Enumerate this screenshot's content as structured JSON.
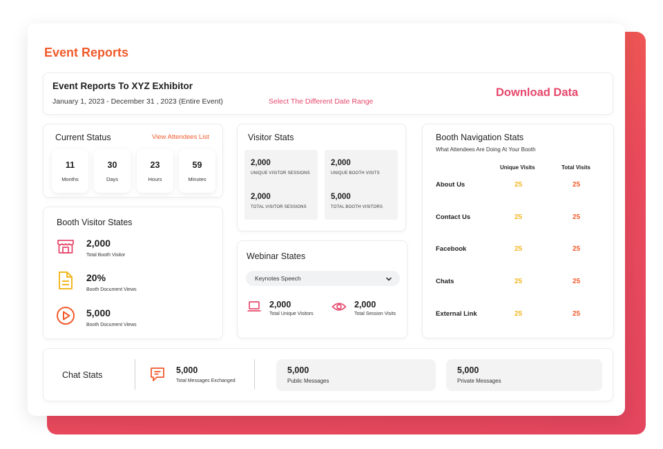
{
  "page_title": "Event Reports",
  "header": {
    "title": "Event Reports To XYZ Exhibitor",
    "dates": "January 1, 2023 - December 31 , 2023 (Entire Event)",
    "range_link": "Select The Different Date Range",
    "download": "Download Data"
  },
  "current_status": {
    "title": "Current Status",
    "link": "View Attendees List",
    "tiles": [
      {
        "value": "11",
        "label": "Months"
      },
      {
        "value": "30",
        "label": "Days"
      },
      {
        "value": "23",
        "label": "Hours"
      },
      {
        "value": "59",
        "label": "Minutes"
      }
    ]
  },
  "booth_visitor": {
    "title": "Booth Visitor States",
    "items": [
      {
        "value": "2,000",
        "label": "Total Booth Visitor",
        "icon": "storefront-icon"
      },
      {
        "value": "20%",
        "label": "Booth Document Views",
        "icon": "document-icon"
      },
      {
        "value": "5,000",
        "label": "Booth Document Views",
        "icon": "play-circle-icon"
      }
    ]
  },
  "visitor_stats": {
    "title": "Visitor Stats",
    "items": [
      {
        "value": "2,000",
        "label": "UNIQUE VISITOR SESSIONS"
      },
      {
        "value": "2,000",
        "label": "UNIQUE BOOTH VISITS"
      },
      {
        "value": "2,000",
        "label": "TOTAL VISITOR SESSIONS"
      },
      {
        "value": "5,000",
        "label": "TOTAL BOOTH VISITORS"
      }
    ]
  },
  "webinar": {
    "title": "Webinar States",
    "selected": "Keynotes Speech",
    "stats": [
      {
        "value": "2,000",
        "label": "Total Unique Visitors",
        "icon": "laptop-icon"
      },
      {
        "value": "2,000",
        "label": "Total Session Visits",
        "icon": "eye-icon"
      }
    ]
  },
  "booth_nav": {
    "title": "Booth Navigation Stats",
    "subtitle": "What Attendees Are Doing At Your Booth",
    "col_unique": "Unique Visits",
    "col_total": "Total Visits",
    "rows": [
      {
        "name": "About Us",
        "unique": "25",
        "total": "25"
      },
      {
        "name": "Contact Us",
        "unique": "25",
        "total": "25"
      },
      {
        "name": "Facebook",
        "unique": "25",
        "total": "25"
      },
      {
        "name": "Chats",
        "unique": "25",
        "total": "25"
      },
      {
        "name": "External Link",
        "unique": "25",
        "total": "25"
      }
    ]
  },
  "chat": {
    "title": "Chat Stats",
    "main": {
      "value": "5,000",
      "label": "Total Messages Exchanged",
      "icon": "chat-icon"
    },
    "public": {
      "value": "5,000",
      "label": "Public Messages"
    },
    "private": {
      "value": "5,000",
      "label": "Private Messages"
    }
  },
  "colors": {
    "brand_orange": "#f15a2b",
    "accent_pink": "#e6476b",
    "unique_yellow": "#f2b621",
    "total_orange": "#f15a2b"
  }
}
